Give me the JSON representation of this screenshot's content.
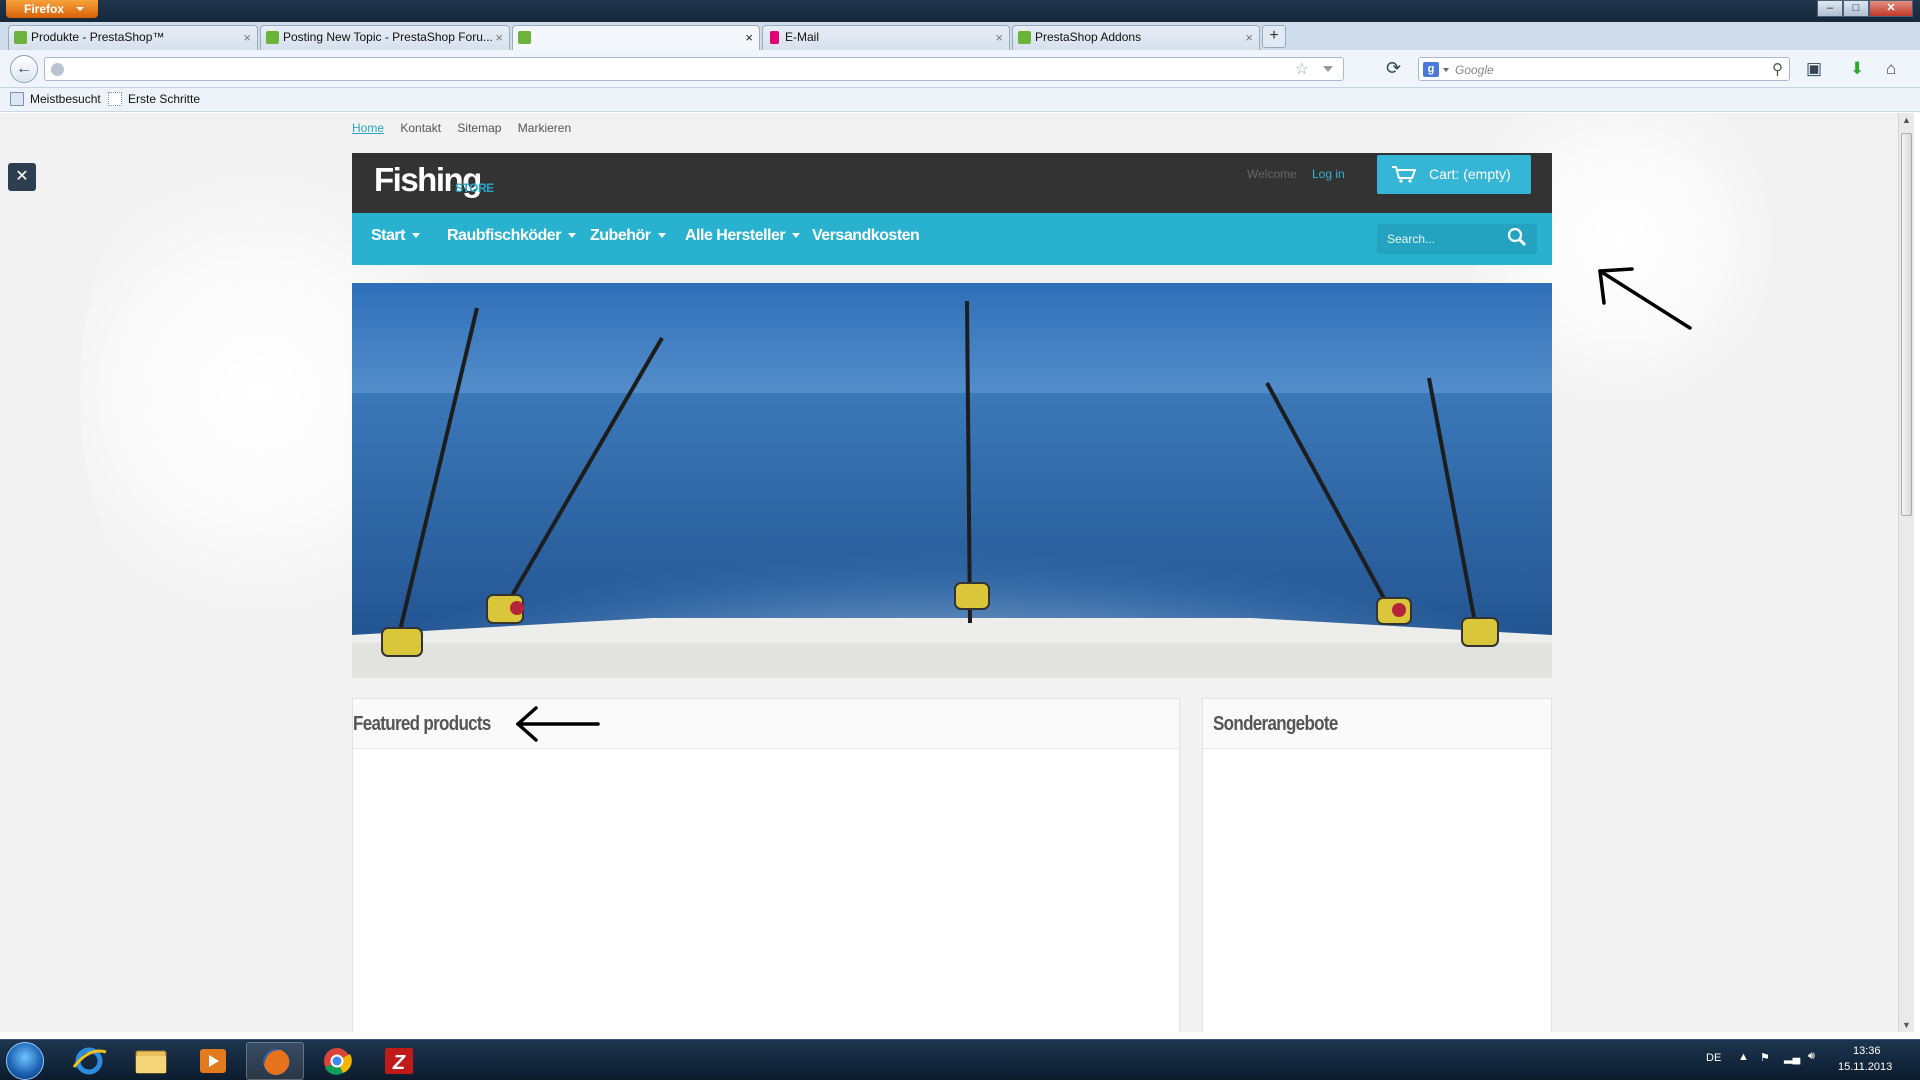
{
  "browser": {
    "app_button": "Firefox",
    "tabs": [
      {
        "title": "Produkte - PrestaShop™"
      },
      {
        "title": "Posting New Topic - PrestaShop Foru..."
      },
      {
        "title": ""
      },
      {
        "title": "E-Mail"
      },
      {
        "title": "PrestaShop Addons"
      }
    ],
    "search_placeholder": "Google",
    "bookmarks": [
      "Meistbesucht",
      "Erste Schritte"
    ]
  },
  "site": {
    "top_links": [
      "Home",
      "Kontakt",
      "Sitemap",
      "Markieren"
    ],
    "logo_main": "Fishing",
    "logo_sub": "STORE",
    "welcome": "Welcome",
    "login": "Log in",
    "cart": "Cart: (empty)",
    "menu": [
      {
        "label": "Start",
        "dropdown": true
      },
      {
        "label": "Raubfischköder",
        "dropdown": true
      },
      {
        "label": "Zubehör",
        "dropdown": true
      },
      {
        "label": "Alle Hersteller",
        "dropdown": true
      },
      {
        "label": "Versandkosten",
        "dropdown": false
      }
    ],
    "search_placeholder": "Search...",
    "featured_title": "Featured products",
    "specials_title": "Sonderangebote",
    "accent_color": "#29b2d0",
    "header_color": "#333333"
  },
  "taskbar": {
    "language": "DE",
    "time": "13:36",
    "date": "15.11.2013"
  }
}
